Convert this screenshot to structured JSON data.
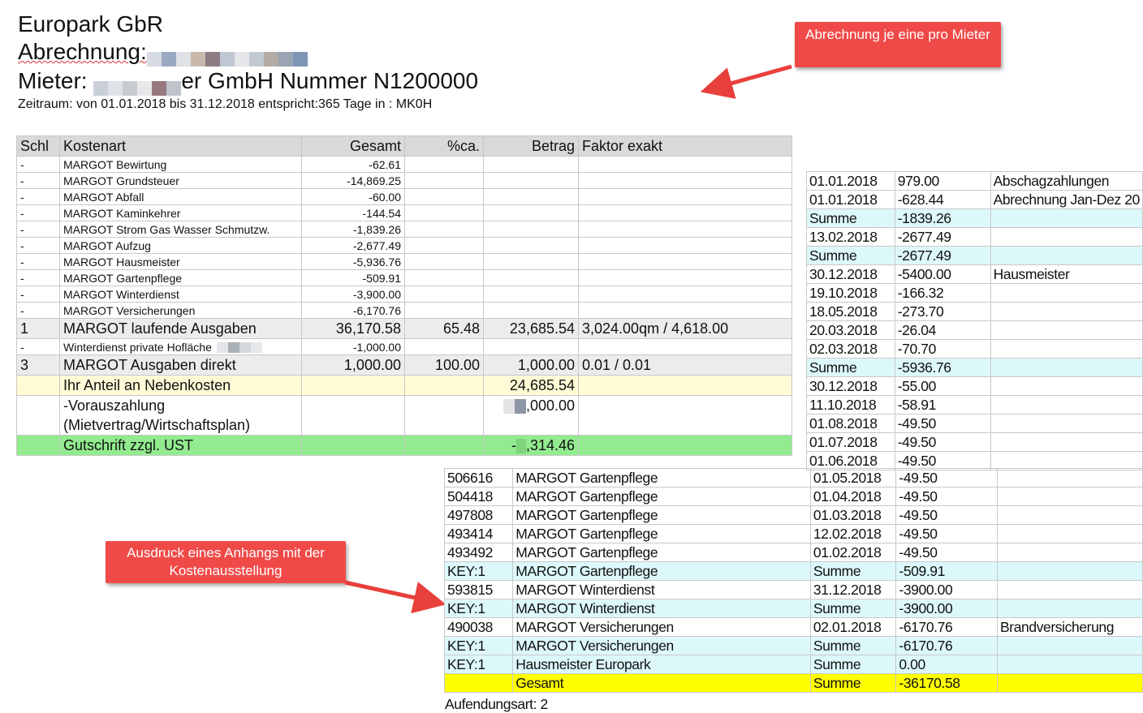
{
  "header": {
    "company": "Europark GbR",
    "abrechnung_label": "Abrechnung:",
    "mieter_label": "Mieter:",
    "mieter_suffix": "er GmbH  Nummer  N1200000",
    "zeitraum": "Zeitraum:  von 01.01.2018 bis 31.12.2018 entspricht:365 Tage in : MK0H"
  },
  "callouts": {
    "top": "Abrechnung je eine pro Mieter",
    "bottom": "Ausdruck eines Anhangs mit der Kostenausstellung"
  },
  "main_table": {
    "headers": [
      "Schl",
      "Kostenart",
      "Gesamt",
      "%ca.",
      "Betrag",
      "Faktor exakt"
    ],
    "rows": [
      {
        "schl": "-",
        "art": "MARGOT Bewirtung",
        "gesamt": "-62.61",
        "pct": "",
        "betrag": "",
        "faktor": ""
      },
      {
        "schl": "-",
        "art": "MARGOT Grundsteuer",
        "gesamt": "-14,869.25",
        "pct": "",
        "betrag": "",
        "faktor": ""
      },
      {
        "schl": "-",
        "art": "MARGOT Abfall",
        "gesamt": "-60.00",
        "pct": "",
        "betrag": "",
        "faktor": ""
      },
      {
        "schl": "-",
        "art": "MARGOT Kaminkehrer",
        "gesamt": "-144.54",
        "pct": "",
        "betrag": "",
        "faktor": ""
      },
      {
        "schl": "-",
        "art": "MARGOT Strom Gas Wasser Schmutzw.",
        "gesamt": "-1,839.26",
        "pct": "",
        "betrag": "",
        "faktor": ""
      },
      {
        "schl": "-",
        "art": "MARGOT Aufzug",
        "gesamt": "-2,677.49",
        "pct": "",
        "betrag": "",
        "faktor": ""
      },
      {
        "schl": "-",
        "art": "MARGOT Hausmeister",
        "gesamt": "-5,936.76",
        "pct": "",
        "betrag": "",
        "faktor": ""
      },
      {
        "schl": "-",
        "art": "MARGOT Gartenpflege",
        "gesamt": "-509.91",
        "pct": "",
        "betrag": "",
        "faktor": ""
      },
      {
        "schl": "-",
        "art": "MARGOT Winterdienst",
        "gesamt": "-3,900.00",
        "pct": "",
        "betrag": "",
        "faktor": ""
      },
      {
        "schl": "-",
        "art": "MARGOT Versicherungen",
        "gesamt": "-6,170.76",
        "pct": "",
        "betrag": "",
        "faktor": ""
      },
      {
        "schl": "1",
        "art": "MARGOT laufende Ausgaben",
        "gesamt": "36,170.58",
        "pct": "65.48",
        "betrag": "23,685.54",
        "faktor": "3,024.00qm  / 4,618.00"
      },
      {
        "schl": "-",
        "art": "Winterdienst private Hofläche",
        "gesamt": "-1,000.00",
        "pct": "",
        "betrag": "",
        "faktor": ""
      },
      {
        "schl": "3",
        "art": "MARGOT Ausgaben direkt",
        "gesamt": "1,000.00",
        "pct": "100.00",
        "betrag": "1,000.00",
        "faktor": "0.01 / 0.01"
      }
    ],
    "anteil_label": "Ihr Anteil an Nebenkosten",
    "anteil_value": "24,685.54",
    "voraus_label1": "-Vorauszahlung",
    "voraus_label2": "(Mietvertrag/Wirtschaftsplan)",
    "voraus_value": ",000.00",
    "gutschrift_label": "Gutschrift  zzgl. UST",
    "gutschrift_value_prefix": "-",
    "gutschrift_value_suffix": ",314.46"
  },
  "side_table": {
    "rows": [
      {
        "a": "01.01.2018",
        "b": "979.00",
        "c": "Abschagzahlungen",
        "cls": ""
      },
      {
        "a": "01.01.2018",
        "b": "-628.44",
        "c": "Abrechnung Jan-Dez 20",
        "cls": ""
      },
      {
        "a": "Summe",
        "b": "-1839.26",
        "c": "",
        "cls": "cyan"
      },
      {
        "a": "13.02.2018",
        "b": "-2677.49",
        "c": "",
        "cls": ""
      },
      {
        "a": "Summe",
        "b": "-2677.49",
        "c": "",
        "cls": "cyan"
      },
      {
        "a": "30.12.2018",
        "b": "-5400.00",
        "c": "Hausmeister",
        "cls": ""
      },
      {
        "a": "19.10.2018",
        "b": "-166.32",
        "c": "",
        "cls": ""
      },
      {
        "a": "18.05.2018",
        "b": "-273.70",
        "c": "",
        "cls": ""
      },
      {
        "a": "20.03.2018",
        "b": "-26.04",
        "c": "",
        "cls": ""
      },
      {
        "a": "02.03.2018",
        "b": "-70.70",
        "c": "",
        "cls": ""
      },
      {
        "a": "Summe",
        "b": "-5936.76",
        "c": "",
        "cls": "cyan"
      },
      {
        "a": "30.12.2018",
        "b": "-55.00",
        "c": "",
        "cls": ""
      },
      {
        "a": "11.10.2018",
        "b": "-58.91",
        "c": "",
        "cls": ""
      },
      {
        "a": "01.08.2018",
        "b": "-49.50",
        "c": "",
        "cls": ""
      },
      {
        "a": "01.07.2018",
        "b": "-49.50",
        "c": "",
        "cls": ""
      },
      {
        "a": "01.06.2018",
        "b": "-49.50",
        "c": "",
        "cls": ""
      }
    ]
  },
  "bottom_table": {
    "rows": [
      {
        "k": "506616",
        "n": "MARGOT Gartenpflege",
        "a": "01.05.2018",
        "b": "-49.50",
        "c": "",
        "cls": ""
      },
      {
        "k": "504418",
        "n": "MARGOT Gartenpflege",
        "a": "01.04.2018",
        "b": "-49.50",
        "c": "",
        "cls": ""
      },
      {
        "k": "497808",
        "n": "MARGOT Gartenpflege",
        "a": "01.03.2018",
        "b": "-49.50",
        "c": "",
        "cls": ""
      },
      {
        "k": "493414",
        "n": "MARGOT Gartenpflege",
        "a": "12.02.2018",
        "b": "-49.50",
        "c": "",
        "cls": ""
      },
      {
        "k": "493492",
        "n": "MARGOT Gartenpflege",
        "a": "01.02.2018",
        "b": "-49.50",
        "c": "",
        "cls": ""
      },
      {
        "k": "KEY:1",
        "n": "MARGOT Gartenpflege",
        "a": "Summe",
        "b": "-509.91",
        "c": "",
        "cls": "cyan"
      },
      {
        "k": "593815",
        "n": "MARGOT Winterdienst",
        "a": "31.12.2018",
        "b": "-3900.00",
        "c": "",
        "cls": ""
      },
      {
        "k": "KEY:1",
        "n": "MARGOT Winterdienst",
        "a": "Summe",
        "b": "-3900.00",
        "c": "",
        "cls": "cyan"
      },
      {
        "k": "490038",
        "n": "MARGOT Versicherungen",
        "a": "02.01.2018",
        "b": "-6170.76",
        "c": "Brandversicherung",
        "cls": ""
      },
      {
        "k": "KEY:1",
        "n": "MARGOT Versicherungen",
        "a": "Summe",
        "b": "-6170.76",
        "c": "",
        "cls": "cyan"
      },
      {
        "k": "KEY:1",
        "n": "Hausmeister Europark",
        "a": "Summe",
        "b": "0.00",
        "c": "",
        "cls": "cyan"
      },
      {
        "k": "",
        "n": "Gesamt",
        "a": "Summe",
        "b": "-36170.58",
        "c": "",
        "cls": "yellow"
      }
    ],
    "footer": "Aufendungsart: 2"
  }
}
